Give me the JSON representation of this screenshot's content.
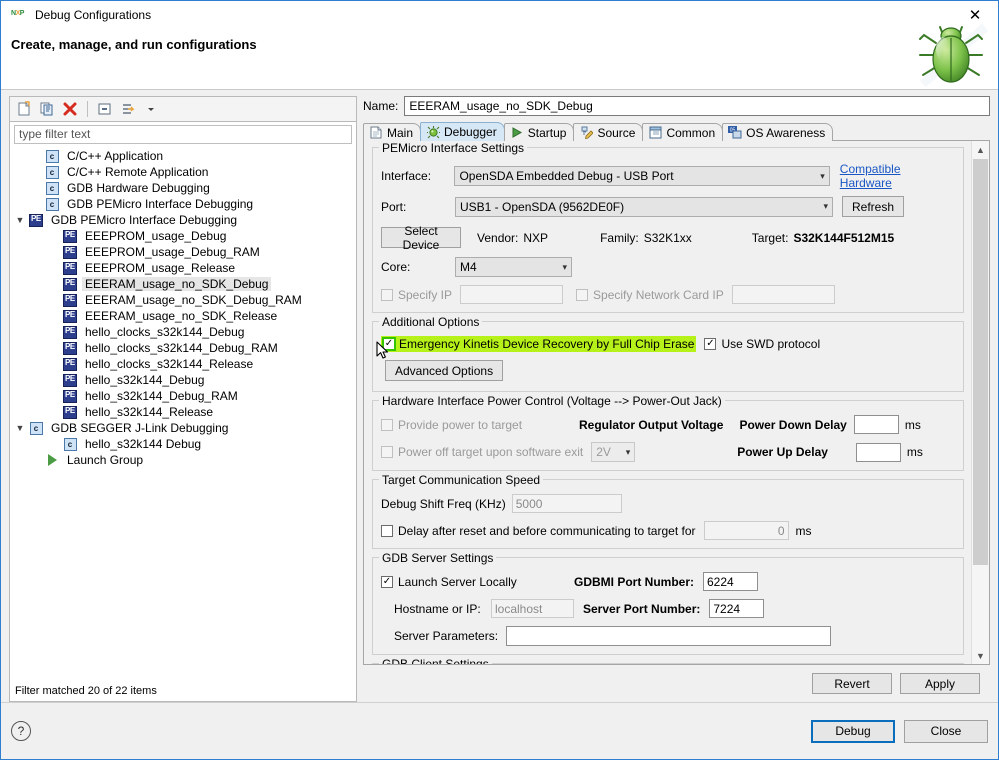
{
  "window": {
    "title": "Debug Configurations",
    "header": "Create, manage, and run configurations",
    "close_label": "✕",
    "app_icon": "nxp-logo-icon",
    "bug_icon": "green-bug-icon"
  },
  "left": {
    "toolbar": [
      {
        "name": "new-configuration-icon",
        "glyph": "new"
      },
      {
        "name": "duplicate-configuration-icon",
        "glyph": "copy"
      },
      {
        "name": "delete-configuration-icon",
        "glyph": "delete"
      },
      {
        "name": "collapse-all-icon",
        "glyph": "collapse"
      },
      {
        "name": "filter-configurations-icon",
        "glyph": "filter"
      },
      {
        "name": "view-menu-chevron-icon",
        "glyph": "chevron"
      }
    ],
    "filter": {
      "placeholder": "type filter text",
      "value": ""
    },
    "tree": [
      {
        "label": "C/C++ Application",
        "icon": "c-file-icon",
        "indent": 1,
        "twisty": "",
        "selected": false
      },
      {
        "label": "C/C++ Remote Application",
        "icon": "c-file-icon",
        "indent": 1,
        "twisty": "",
        "selected": false
      },
      {
        "label": "GDB Hardware Debugging",
        "icon": "c-file-icon",
        "indent": 1,
        "twisty": "",
        "selected": false
      },
      {
        "label": "GDB PEMicro Interface Debugging",
        "icon": "c-file-icon",
        "indent": 1,
        "twisty": "",
        "selected": false
      },
      {
        "label": "GDB PEMicro Interface Debugging",
        "icon": "pemicro-icon",
        "indent": 0,
        "twisty": "expanded",
        "selected": false
      },
      {
        "label": "EEEPROM_usage_Debug",
        "icon": "pemicro-icon",
        "indent": 2,
        "twisty": "",
        "selected": false
      },
      {
        "label": "EEEPROM_usage_Debug_RAM",
        "icon": "pemicro-icon",
        "indent": 2,
        "twisty": "",
        "selected": false
      },
      {
        "label": "EEEPROM_usage_Release",
        "icon": "pemicro-icon",
        "indent": 2,
        "twisty": "",
        "selected": false
      },
      {
        "label": "EEERAM_usage_no_SDK_Debug",
        "icon": "pemicro-icon",
        "indent": 2,
        "twisty": "",
        "selected": true
      },
      {
        "label": "EEERAM_usage_no_SDK_Debug_RAM",
        "icon": "pemicro-icon",
        "indent": 2,
        "twisty": "",
        "selected": false
      },
      {
        "label": "EEERAM_usage_no_SDK_Release",
        "icon": "pemicro-icon",
        "indent": 2,
        "twisty": "",
        "selected": false
      },
      {
        "label": "hello_clocks_s32k144_Debug",
        "icon": "pemicro-icon",
        "indent": 2,
        "twisty": "",
        "selected": false
      },
      {
        "label": "hello_clocks_s32k144_Debug_RAM",
        "icon": "pemicro-icon",
        "indent": 2,
        "twisty": "",
        "selected": false
      },
      {
        "label": "hello_clocks_s32k144_Release",
        "icon": "pemicro-icon",
        "indent": 2,
        "twisty": "",
        "selected": false
      },
      {
        "label": "hello_s32k144_Debug",
        "icon": "pemicro-icon",
        "indent": 2,
        "twisty": "",
        "selected": false
      },
      {
        "label": "hello_s32k144_Debug_RAM",
        "icon": "pemicro-icon",
        "indent": 2,
        "twisty": "",
        "selected": false
      },
      {
        "label": "hello_s32k144_Release",
        "icon": "pemicro-icon",
        "indent": 2,
        "twisty": "",
        "selected": false
      },
      {
        "label": "GDB SEGGER J-Link Debugging",
        "icon": "c-file-icon",
        "indent": 0,
        "twisty": "expanded",
        "selected": false
      },
      {
        "label": "hello_s32k144 Debug",
        "icon": "c-file-icon",
        "indent": 2,
        "twisty": "",
        "selected": false
      },
      {
        "label": "Launch Group",
        "icon": "launch-group-icon",
        "indent": 1,
        "twisty": "",
        "selected": false
      }
    ],
    "status": "Filter matched 20 of 22 items"
  },
  "right": {
    "name_label": "Name:",
    "name_value": "EEERAM_usage_no_SDK_Debug",
    "tabs": [
      {
        "label": "Main",
        "icon": "document-icon",
        "active": false
      },
      {
        "label": "Debugger",
        "icon": "debugger-icon",
        "active": true
      },
      {
        "label": "Startup",
        "icon": "startup-play-icon",
        "active": false
      },
      {
        "label": "Source",
        "icon": "source-pencil-icon",
        "active": false
      },
      {
        "label": "Common",
        "icon": "common-window-icon",
        "active": false
      },
      {
        "label": "OS Awareness",
        "icon": "os-awareness-icon",
        "active": false
      }
    ],
    "pemicro": {
      "group_label": "PEMicro Interface Settings",
      "interface_label": "Interface:",
      "interface_value": "OpenSDA Embedded Debug - USB Port",
      "compatible_hardware_link": "Compatible Hardware",
      "port_label": "Port:",
      "port_value": "USB1 - OpenSDA (9562DE0F)",
      "refresh_label": "Refresh",
      "select_device_label": "Select Device",
      "vendor_label": "Vendor:",
      "vendor_value": "NXP",
      "family_label": "Family:",
      "family_value": "S32K1xx",
      "target_label": "Target:",
      "target_value": "S32K144F512M15",
      "core_label": "Core:",
      "core_value": "M4",
      "specify_ip_label": "Specify IP",
      "specify_ip_checked": false,
      "specify_ip_value": "",
      "specify_network_card_ip_label": "Specify Network Card IP",
      "specify_network_card_ip_checked": false,
      "specify_network_card_ip_value": ""
    },
    "additional": {
      "group_label": "Additional Options",
      "emergency_label": "Emergency Kinetis Device Recovery by Full Chip Erase",
      "emergency_checked": true,
      "emergency_highlight_color": "#b6f11a",
      "use_swd_label": "Use SWD protocol",
      "use_swd_checked": true,
      "advanced_options_label": "Advanced Options"
    },
    "power": {
      "group_label": "Hardware Interface Power Control (Voltage --> Power-Out Jack)",
      "provide_power_label": "Provide power to target",
      "provide_power_checked": false,
      "power_off_exit_label": "Power off target upon software exit",
      "power_off_exit_checked": false,
      "regulator_label": "Regulator Output Voltage",
      "regulator_value": "2V",
      "power_down_delay_label": "Power Down Delay",
      "power_down_delay_value": "",
      "power_up_delay_label": "Power Up Delay",
      "power_up_delay_value": "",
      "ms_unit": "ms"
    },
    "speed": {
      "group_label": "Target Communication Speed",
      "shift_freq_label": "Debug Shift Freq (KHz)",
      "shift_freq_value": "5000",
      "delay_after_reset_label": "Delay after reset and before communicating to target for",
      "delay_after_reset_checked": false,
      "delay_after_reset_value": "0",
      "ms_unit": "ms"
    },
    "gdbserver": {
      "group_label": "GDB Server Settings",
      "launch_local_label": "Launch Server Locally",
      "launch_local_checked": true,
      "gdbmi_port_label": "GDBMI Port Number:",
      "gdbmi_port_value": "6224",
      "hostname_label": "Hostname or IP:",
      "hostname_value": "localhost",
      "server_port_label": "Server Port Number:",
      "server_port_value": "7224",
      "server_params_label": "Server Parameters:",
      "server_params_value": ""
    },
    "gdbclient": {
      "group_label": "GDB Client Settings"
    },
    "revert_label": "Revert",
    "apply_label": "Apply"
  },
  "footer": {
    "help_icon": "help-question-icon",
    "debug_label": "Debug",
    "close_label": "Close"
  }
}
